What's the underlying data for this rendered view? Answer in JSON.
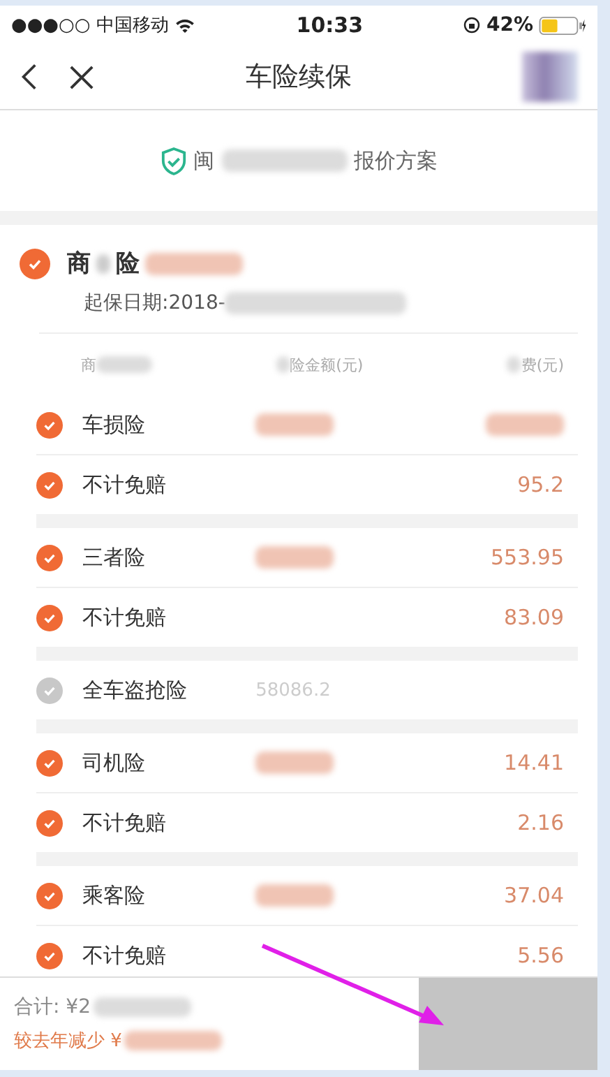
{
  "status_bar": {
    "signal": "●●●○○",
    "carrier": "中国移动",
    "time": "10:33",
    "battery": "42%"
  },
  "nav": {
    "title": "车险续保",
    "avatar_redacted": true
  },
  "banner": {
    "prefix": "闽",
    "suffix": "报价方案"
  },
  "section": {
    "title_start": "商",
    "title_end": "险",
    "checked": true,
    "date": "起保日期:2018-"
  },
  "columns": [
    "商",
    "险金额(元)",
    "费(元)"
  ],
  "groups": [
    {
      "rows": [
        {
          "name": "车损险",
          "checked": true,
          "amount_redacted": true,
          "premium_redacted": true
        },
        {
          "name": "不计免赔",
          "checked": true,
          "premium": "95.2"
        }
      ]
    },
    {
      "rows": [
        {
          "name": "三者险",
          "checked": true,
          "amount_redacted": true,
          "premium": "553.95"
        },
        {
          "name": "不计免赔",
          "checked": true,
          "premium": "83.09"
        }
      ]
    },
    {
      "rows": [
        {
          "name": "全车盗抢险",
          "checked": false,
          "amount": "58086.2"
        }
      ]
    },
    {
      "rows": [
        {
          "name": "司机险",
          "checked": true,
          "amount_redacted": true,
          "premium": "14.41"
        },
        {
          "name": "不计免赔",
          "checked": true,
          "premium": "2.16"
        }
      ]
    },
    {
      "rows": [
        {
          "name": "乘客险",
          "checked": true,
          "amount_redacted": true,
          "premium": "37.04"
        },
        {
          "name": "不计免赔",
          "checked": true,
          "premium": "5.56"
        }
      ]
    }
  ],
  "footer": {
    "total": "合计: ¥2",
    "saving": "较去年减少 ¥"
  }
}
